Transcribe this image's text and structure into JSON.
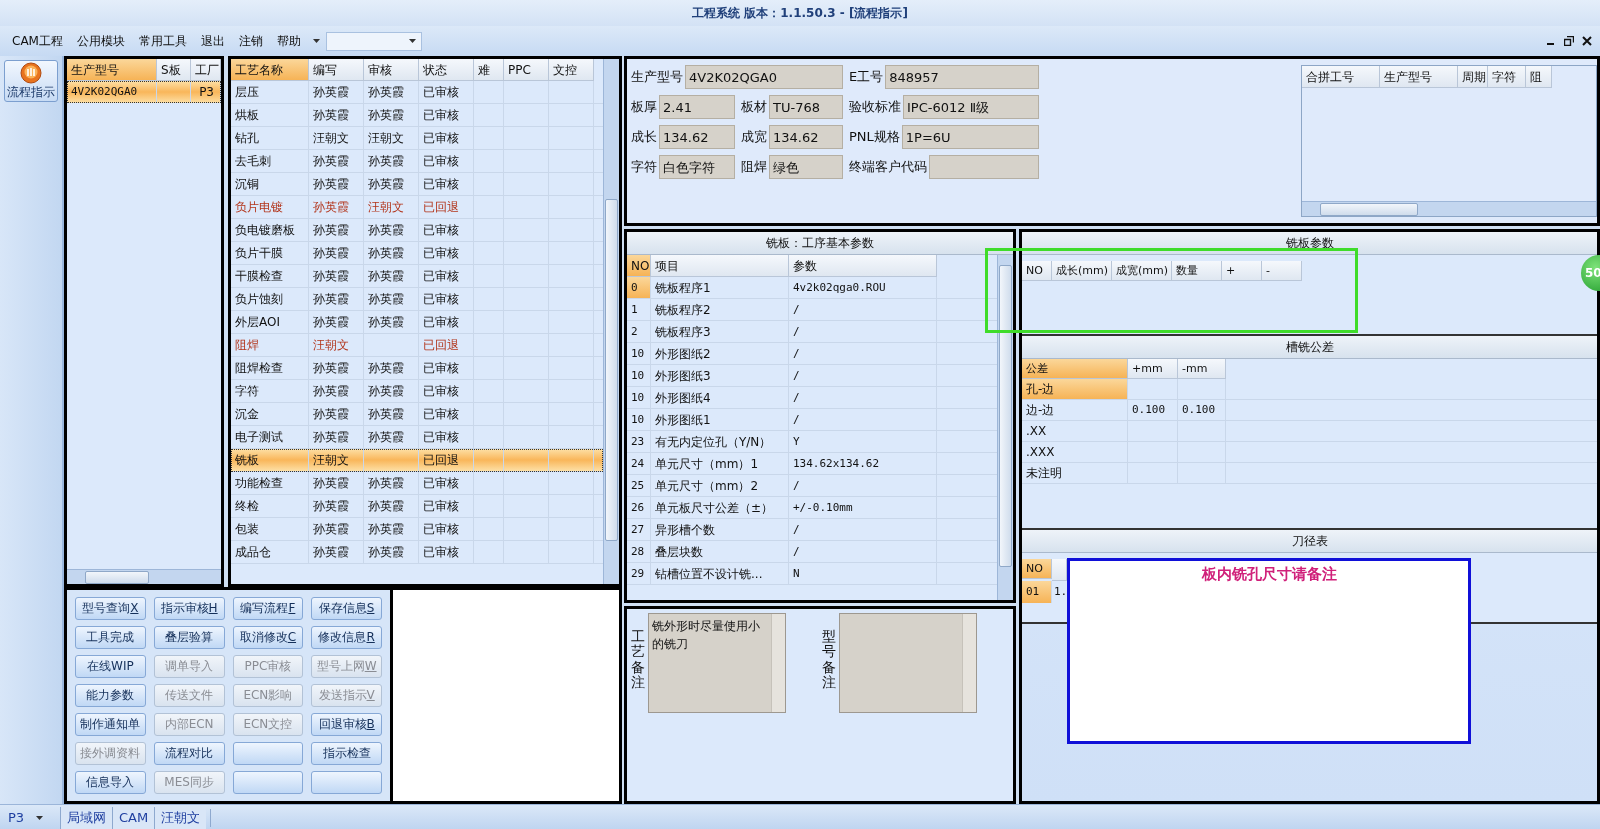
{
  "window": {
    "title": "工程系统  版本：1.1.50.3 - [流程指示]"
  },
  "menu": [
    "CAM工程",
    "公用模块",
    "常用工具",
    "退出",
    "注销",
    "帮助"
  ],
  "nav": [
    {
      "label": "流程指示",
      "selected": true
    }
  ],
  "model_list": {
    "columns": [
      "生产型号",
      "S板",
      "工厂"
    ],
    "rows": [
      {
        "model": "4V2K02QGA0",
        "factory": "P3",
        "selected": true
      }
    ]
  },
  "process": {
    "columns": [
      "工艺名称",
      "编写",
      "审核",
      "状态",
      "难",
      "PPC",
      "文控"
    ],
    "rows": [
      {
        "name": "层压",
        "writer": "孙英霞",
        "reviewer": "孙英霞",
        "status": "已审核",
        "returned": false,
        "selected": false
      },
      {
        "name": "烘板",
        "writer": "孙英霞",
        "reviewer": "孙英霞",
        "status": "已审核",
        "returned": false,
        "selected": false
      },
      {
        "name": "钻孔",
        "writer": "汪朝文",
        "reviewer": "汪朝文",
        "status": "已审核",
        "returned": false,
        "selected": false
      },
      {
        "name": "去毛刺",
        "writer": "孙英霞",
        "reviewer": "孙英霞",
        "status": "已审核",
        "returned": false,
        "selected": false
      },
      {
        "name": "沉铜",
        "writer": "孙英霞",
        "reviewer": "孙英霞",
        "status": "已审核",
        "returned": false,
        "selected": false
      },
      {
        "name": "负片电镀",
        "writer": "孙英霞",
        "reviewer": "汪朝文",
        "status": "已回退",
        "returned": true,
        "selected": false
      },
      {
        "name": "负电镀磨板",
        "writer": "孙英霞",
        "reviewer": "孙英霞",
        "status": "已审核",
        "returned": false,
        "selected": false
      },
      {
        "name": "负片干膜",
        "writer": "孙英霞",
        "reviewer": "孙英霞",
        "status": "已审核",
        "returned": false,
        "selected": false
      },
      {
        "name": "干膜检查",
        "writer": "孙英霞",
        "reviewer": "孙英霞",
        "status": "已审核",
        "returned": false,
        "selected": false
      },
      {
        "name": "负片蚀刻",
        "writer": "孙英霞",
        "reviewer": "孙英霞",
        "status": "已审核",
        "returned": false,
        "selected": false
      },
      {
        "name": "外层AOI",
        "writer": "孙英霞",
        "reviewer": "孙英霞",
        "status": "已审核",
        "returned": false,
        "selected": false
      },
      {
        "name": "阻焊",
        "writer": "汪朝文",
        "status": "已回退",
        "returned": true,
        "selected": false
      },
      {
        "name": "阻焊检查",
        "writer": "孙英霞",
        "reviewer": "孙英霞",
        "status": "已审核",
        "returned": false,
        "selected": false
      },
      {
        "name": "字符",
        "writer": "孙英霞",
        "reviewer": "孙英霞",
        "status": "已审核",
        "returned": false,
        "selected": false
      },
      {
        "name": "沉金",
        "writer": "孙英霞",
        "reviewer": "孙英霞",
        "status": "已审核",
        "returned": false,
        "selected": false
      },
      {
        "name": "电子测试",
        "writer": "孙英霞",
        "reviewer": "孙英霞",
        "status": "已审核",
        "returned": false,
        "selected": false
      },
      {
        "name": "铣板",
        "writer": "汪朝文",
        "status": "已回退",
        "returned": true,
        "selected": true
      },
      {
        "name": "功能检查",
        "writer": "孙英霞",
        "reviewer": "孙英霞",
        "status": "已审核",
        "returned": false,
        "selected": false
      },
      {
        "name": "终检",
        "writer": "孙英霞",
        "reviewer": "孙英霞",
        "status": "已审核",
        "returned": false,
        "selected": false
      },
      {
        "name": "包装",
        "writer": "孙英霞",
        "reviewer": "孙英霞",
        "status": "已审核",
        "returned": false,
        "selected": false
      },
      {
        "name": "成品仓",
        "writer": "孙英霞",
        "reviewer": "孙英霞",
        "status": "已审核",
        "returned": false,
        "selected": false
      }
    ]
  },
  "buttons": [
    {
      "label": "型号查询",
      "key": "X",
      "disabled": false
    },
    {
      "label": "指示审核",
      "key": "H",
      "disabled": false
    },
    {
      "label": "编写流程",
      "key": "F",
      "disabled": false
    },
    {
      "label": "保存信息",
      "key": "S",
      "disabled": false
    },
    {
      "label": "工具完成",
      "disabled": false
    },
    {
      "label": "叠层验算",
      "disabled": false
    },
    {
      "label": "取消修改",
      "key": "C",
      "disabled": false
    },
    {
      "label": "修改信息",
      "key": "R",
      "disabled": false
    },
    {
      "label": "在线WIP",
      "disabled": false
    },
    {
      "label": "调单导入",
      "disabled": true
    },
    {
      "label": "PPC审核",
      "disabled": true
    },
    {
      "label": "型号上网",
      "key": "W",
      "disabled": true
    },
    {
      "label": "能力参数",
      "disabled": false
    },
    {
      "label": "传送文件",
      "disabled": true
    },
    {
      "label": "ECN影响",
      "disabled": true
    },
    {
      "label": "发送指示",
      "key": "V",
      "disabled": true
    },
    {
      "label": "制作通知单",
      "disabled": false
    },
    {
      "label": "内部ECN",
      "disabled": true
    },
    {
      "label": "ECN文控",
      "disabled": true
    },
    {
      "label": "回退审核",
      "key": "B",
      "disabled": false
    },
    {
      "label": "接外调资料",
      "disabled": true
    },
    {
      "label": "流程对比",
      "disabled": false
    },
    {
      "disabled": false
    },
    {
      "label": "指示检查",
      "disabled": false
    },
    {
      "label": "信息导入",
      "disabled": false
    },
    {
      "label": "MES同步",
      "disabled": true
    },
    {
      "disabled": false
    },
    {
      "disabled": false
    }
  ],
  "info": {
    "fields": [
      {
        "label": "生产型号",
        "value": "4V2K02QGA0"
      },
      {
        "label": "E工号",
        "value": "848957"
      },
      {
        "label": "板厚",
        "value": "2.41"
      },
      {
        "label": "板材",
        "value": "TU-768"
      },
      {
        "label": "验收标准",
        "value": "IPC-6012 Ⅱ级"
      },
      {
        "label": "成长",
        "value": "134.62"
      },
      {
        "label": "成宽",
        "value": "134.62"
      },
      {
        "label": "PNL规格",
        "value": "1P=6U"
      },
      {
        "label": "字符",
        "value": "白色字符"
      },
      {
        "label": "阻焊",
        "value": "绿色"
      },
      {
        "label": "终端客户代码"
      }
    ]
  },
  "merge_table": {
    "columns": [
      "合拼工号",
      "生产型号",
      "周期",
      "字符",
      "阻"
    ]
  },
  "milling": {
    "title": "铣板：工序基本参数",
    "columns": [
      "NO",
      "项目",
      "参数"
    ],
    "rows": [
      {
        "no": "0",
        "item": "铣板程序1",
        "value": "4v2k02qga0.ROU",
        "selected": true
      },
      {
        "no": "1",
        "item": "铣板程序2",
        "value": "/",
        "selected": false
      },
      {
        "no": "2",
        "item": "铣板程序3",
        "value": "/",
        "selected": false
      },
      {
        "no": "10",
        "item": "外形图纸2",
        "value": "/",
        "selected": false
      },
      {
        "no": "10",
        "item": "外形图纸3",
        "value": "/",
        "selected": false
      },
      {
        "no": "10",
        "item": "外形图纸4",
        "value": "/",
        "selected": false
      },
      {
        "no": "10",
        "item": "外形图纸1",
        "value": "/",
        "selected": false
      },
      {
        "no": "23",
        "item": "有无内定位孔（Y/N）",
        "value": "Y",
        "selected": false
      },
      {
        "no": "24",
        "item": "单元尺寸（mm）1",
        "value": "134.62x134.62",
        "selected": false
      },
      {
        "no": "25",
        "item": "单元尺寸（mm）2",
        "value": "/",
        "selected": false
      },
      {
        "no": "26",
        "item": "单元板尺寸公差（±）",
        "value": "+/-0.10mm",
        "selected": false
      },
      {
        "no": "27",
        "item": "异形槽个数",
        "value": "/",
        "selected": false
      },
      {
        "no": "28",
        "item": "叠层块数",
        "value": "/",
        "selected": false
      },
      {
        "no": "29",
        "item": "钻槽位置不设计铣...",
        "value": "N",
        "selected": false
      }
    ]
  },
  "mill_params": {
    "title": "铣板参数",
    "columns": [
      "NO",
      "成长(mm)",
      "成宽(mm)",
      "数量",
      "+",
      "-"
    ]
  },
  "slot_tolerance": {
    "title": "槽铣公差",
    "columns": [
      "公差",
      "+mm",
      "-mm"
    ],
    "rows": [
      {
        "name": "孔-边",
        "selected": true
      },
      {
        "name": "边-边",
        "plus": "0.100",
        "minus": "0.100",
        "selected": false
      },
      {
        "name": ".XX",
        "selected": false
      },
      {
        "name": ".XXX",
        "selected": false
      },
      {
        "name": "未注明",
        "selected": false
      }
    ]
  },
  "cutter_table": {
    "title": "刀径表",
    "columns": [
      "NO"
    ],
    "rows": [
      {
        "no": "01",
        "diameter": "1."
      }
    ]
  },
  "remarks": {
    "process": {
      "label": "工艺备注",
      "text": "铣外形时尽量使用小的铣刀"
    },
    "model": {
      "label": "型号备注"
    }
  },
  "note": {
    "text": "板内铣孔尺寸请备注"
  },
  "badge": {
    "text": "50"
  },
  "status_bar": {
    "factory": "P3",
    "items": [
      "局域网",
      "CAM",
      "汪朝文"
    ]
  }
}
